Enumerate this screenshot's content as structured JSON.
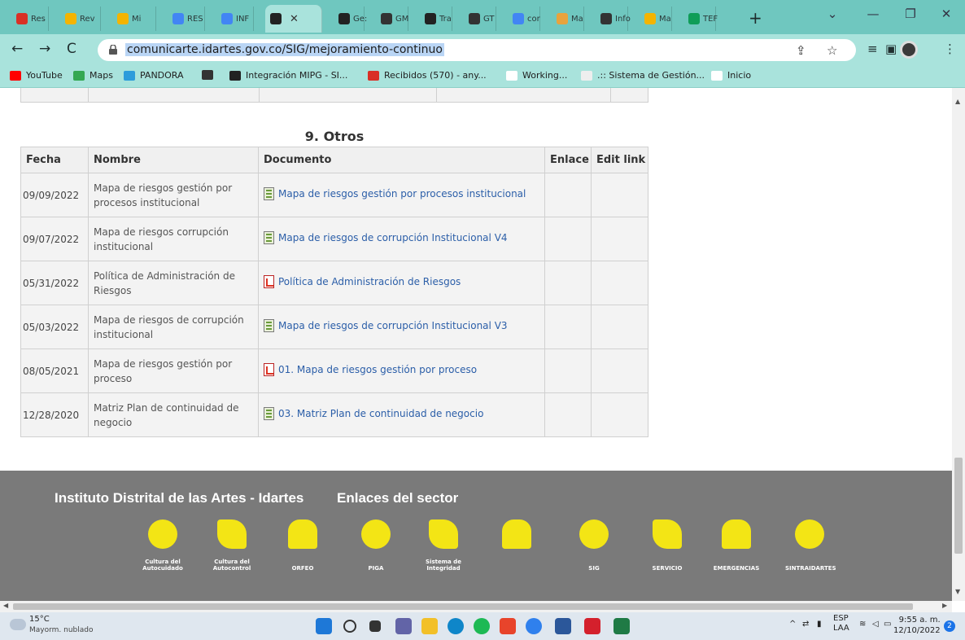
{
  "browser": {
    "tabs": [
      {
        "label": "Res",
        "icon": "gmail-icon",
        "color": "#d93025"
      },
      {
        "label": "Rev",
        "icon": "drive-icon",
        "color": "#f4b400"
      },
      {
        "label": "Mi",
        "icon": "drive-icon",
        "color": "#f4b400"
      },
      {
        "label": "RES",
        "icon": "docs-icon",
        "color": "#4285f4"
      },
      {
        "label": "INF",
        "icon": "docs-icon",
        "color": "#4285f4"
      },
      {
        "label": "",
        "icon": "site-icon",
        "color": "#222222",
        "active": true
      },
      {
        "label": "Ge:",
        "icon": "site-icon",
        "color": "#222222"
      },
      {
        "label": "GM",
        "icon": "globe-icon",
        "color": "#333333"
      },
      {
        "label": "Tra",
        "icon": "site-icon",
        "color": "#222222"
      },
      {
        "label": "GT",
        "icon": "globe-icon",
        "color": "#333333"
      },
      {
        "label": "cor",
        "icon": "google-icon",
        "color": "#4285f4"
      },
      {
        "label": "Ma",
        "icon": "site-icon",
        "color": "#e8a33d"
      },
      {
        "label": "Info",
        "icon": "globe-icon",
        "color": "#333333"
      },
      {
        "label": "Ma",
        "icon": "drive-icon",
        "color": "#f4b400"
      },
      {
        "label": "TEF",
        "icon": "plus-icon",
        "color": "#0f9d58"
      }
    ],
    "url": "comunicarte.idartes.gov.co/SIG/mejoramiento-continuo",
    "bookmarks": [
      {
        "label": "YouTube",
        "color": "#ff0000"
      },
      {
        "label": "Maps",
        "color": "#34a853"
      },
      {
        "label": "PANDORA",
        "color": "#2d9cdb"
      },
      {
        "label": "",
        "color": "#333333"
      },
      {
        "label": "Integración MIPG - SI...",
        "color": "#222222"
      },
      {
        "label": "Recibidos (570) - any...",
        "color": "#d93025"
      },
      {
        "label": "Working...",
        "color": "#ffffff"
      },
      {
        "label": ".:: Sistema de Gestión...",
        "color": "#eeeeee"
      },
      {
        "label": "Inicio",
        "color": "#ffffff"
      }
    ],
    "accent": "#6fc7bf"
  },
  "section": {
    "title": "9. Otros",
    "headers": {
      "fecha": "Fecha",
      "nombre": "Nombre",
      "documento": "Documento",
      "enlace": "Enlace",
      "edit": "Edit link"
    },
    "rows": [
      {
        "fecha": "09/09/2022",
        "nombre": "Mapa de riesgos gestión por procesos institucional",
        "documento": "Mapa de riesgos gestión por procesos institucional",
        "type": "xls"
      },
      {
        "fecha": "09/07/2022",
        "nombre": "Mapa de riesgos corrupción institucional",
        "documento": "Mapa de riesgos de corrupción Institucional V4",
        "type": "xls"
      },
      {
        "fecha": "05/31/2022",
        "nombre": "Política de Administración de Riesgos",
        "documento": "Política de Administración de Riesgos",
        "type": "pdf"
      },
      {
        "fecha": "05/03/2022",
        "nombre": "Mapa de riesgos de corrupción institucional",
        "documento": "Mapa de riesgos de corrupción Institucional V3",
        "type": "xls"
      },
      {
        "fecha": "08/05/2021",
        "nombre": "Mapa de riesgos gestión por proceso",
        "documento": "01. Mapa de riesgos gestión por proceso",
        "type": "pdf"
      },
      {
        "fecha": "12/28/2020",
        "nombre": "Matriz Plan de continuidad de negocio",
        "documento": "03. Matriz Plan de continuidad de negocio",
        "type": "xls"
      }
    ]
  },
  "footer": {
    "heading_left": "Instituto Distrital de las Artes - Idartes",
    "heading_right": "Enlaces del sector",
    "logos": [
      {
        "label": "Cultura del Autocuidado"
      },
      {
        "label": "Cultura del Autocontrol"
      },
      {
        "label": "ORFEO"
      },
      {
        "label": "PIGA"
      },
      {
        "label": "Sistema de Integridad"
      },
      {
        "label": ""
      },
      {
        "label": "SIG"
      },
      {
        "label": "SERVICIO"
      },
      {
        "label": "EMERGENCIAS"
      },
      {
        "label": "SINTRAIDARTES"
      }
    ],
    "brand_color": "#f3e515"
  },
  "taskbar": {
    "temperature": "15°C",
    "weather": "Mayorm. nublado",
    "lang_top": "ESP",
    "lang_bottom": "LAA",
    "time": "9:55 a. m.",
    "date": "12/10/2022",
    "notifications": "2"
  }
}
